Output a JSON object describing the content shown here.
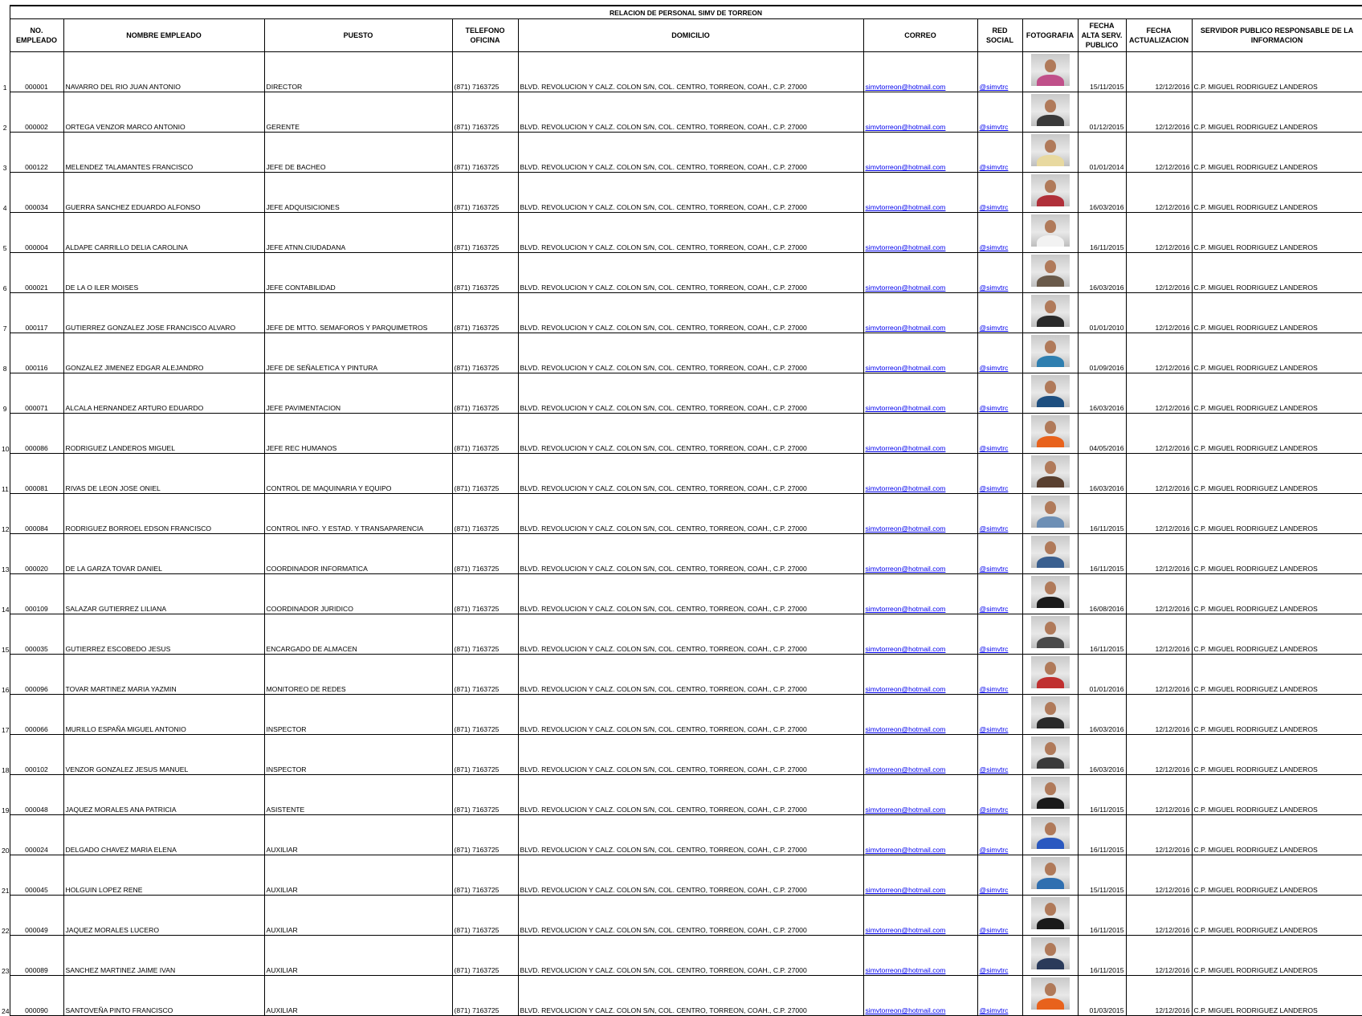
{
  "title": "RELACION DE PERSONAL SIMV DE TORREON",
  "headers": {
    "num": "NO. EMPLEADO",
    "nombre": "NOMBRE EMPLEADO",
    "puesto": "PUESTO",
    "telefono": "TELEFONO OFICINA",
    "domicilio": "DOMICILIO",
    "correo": "CORREO",
    "red": "RED SOCIAL",
    "foto": "FOTOGRAFIA",
    "alta": "FECHA ALTA SERV. PUBLICO",
    "actualizacion": "FECHA ACTUALIZACION",
    "responsable": "SERVIDOR PUBLICO RESPONSABLE DE LA INFORMACION"
  },
  "rows": [
    {
      "n": "1",
      "num": "000001",
      "nombre": "NAVARRO DEL RIO JUAN ANTONIO",
      "puesto": "DIRECTOR",
      "telefono": "(871) 7163725",
      "domicilio": "BLVD. REVOLUCION Y CALZ. COLON S/N, COL. CENTRO, TORREON, COAH., C.P. 27000",
      "correo": "simvtorreon@hotmail.com",
      "red": "@simvtrc",
      "alta": "15/11/2015",
      "act": "12/12/2016",
      "resp": "C.P. MIGUEL RODRIGUEZ LANDEROS",
      "shirt": "#c0508a"
    },
    {
      "n": "2",
      "num": "000002",
      "nombre": "ORTEGA VENZOR MARCO ANTONIO",
      "puesto": "GERENTE",
      "telefono": "(871) 7163725",
      "domicilio": "BLVD. REVOLUCION Y CALZ. COLON S/N, COL. CENTRO, TORREON, COAH., C.P. 27000",
      "correo": "simvtorreon@hotmail.com",
      "red": "@simvtrc",
      "alta": "01/12/2015",
      "act": "12/12/2016",
      "resp": "C.P. MIGUEL RODRIGUEZ LANDEROS",
      "shirt": "#3a3a3a"
    },
    {
      "n": "3",
      "num": "000122",
      "nombre": "MELENDEZ TALAMANTES FRANCISCO",
      "puesto": "JEFE  DE BACHEO",
      "telefono": "(871) 7163725",
      "domicilio": "BLVD. REVOLUCION Y CALZ. COLON S/N, COL. CENTRO, TORREON, COAH., C.P. 27000",
      "correo": "simvtorreon@hotmail.com",
      "red": "@simvtrc",
      "alta": "01/01/2014",
      "act": "12/12/2016",
      "resp": "C.P. MIGUEL RODRIGUEZ LANDEROS",
      "shirt": "#e8d9a0"
    },
    {
      "n": "4",
      "num": "000034",
      "nombre": "GUERRA SANCHEZ EDUARDO ALFONSO",
      "puesto": "JEFE ADQUISICIONES",
      "telefono": "(871) 7163725",
      "domicilio": "BLVD. REVOLUCION Y CALZ. COLON S/N, COL. CENTRO, TORREON, COAH., C.P. 27000",
      "correo": "simvtorreon@hotmail.com",
      "red": "@simvtrc",
      "alta": "16/03/2016",
      "act": "12/12/2016",
      "resp": "C.P. MIGUEL RODRIGUEZ LANDEROS",
      "shirt": "#b0303a"
    },
    {
      "n": "5",
      "num": "000004",
      "nombre": "ALDAPE CARRILLO DELIA CAROLINA",
      "puesto": "JEFE ATNN.CIUDADANA",
      "telefono": "(871) 7163725",
      "domicilio": "BLVD. REVOLUCION Y CALZ. COLON S/N, COL. CENTRO, TORREON, COAH., C.P. 27000",
      "correo": "simvtorreon@hotmail.com",
      "red": "@simvtrc",
      "alta": "16/11/2015",
      "act": "12/12/2016",
      "resp": "C.P. MIGUEL RODRIGUEZ LANDEROS",
      "shirt": "#f2f2f2"
    },
    {
      "n": "6",
      "num": "000021",
      "nombre": "DE LA O ILER MOISES",
      "puesto": "JEFE CONTABILIDAD",
      "telefono": "(871) 7163725",
      "domicilio": "BLVD. REVOLUCION Y CALZ. COLON S/N, COL. CENTRO, TORREON, COAH., C.P. 27000",
      "correo": "simvtorreon@hotmail.com",
      "red": "@simvtrc",
      "alta": "16/03/2016",
      "act": "12/12/2016",
      "resp": "C.P. MIGUEL RODRIGUEZ LANDEROS",
      "shirt": "#6a5a4a"
    },
    {
      "n": "7",
      "num": "000117",
      "nombre": "GUTIERREZ GONZALEZ JOSE FRANCISCO ALVARO",
      "puesto": "JEFE DE MTTO.  SEMAFOROS Y PARQUIMETROS",
      "telefono": "(871) 7163725",
      "domicilio": "BLVD. REVOLUCION Y CALZ. COLON S/N, COL. CENTRO, TORREON, COAH., C.P. 27000",
      "correo": "simvtorreon@hotmail.com",
      "red": "@simvtrc",
      "alta": "01/01/2010",
      "act": "12/12/2016",
      "resp": "C.P. MIGUEL RODRIGUEZ LANDEROS",
      "shirt": "#2a2a2a"
    },
    {
      "n": "8",
      "num": "000116",
      "nombre": "GONZALEZ JIMENEZ EDGAR ALEJANDRO",
      "puesto": "JEFE DE SEÑALETICA Y PINTURA",
      "telefono": "(871) 7163725",
      "domicilio": "BLVD. REVOLUCION Y CALZ. COLON S/N, COL. CENTRO, TORREON, COAH., C.P. 27000",
      "correo": "simvtorreon@hotmail.com",
      "red": "@simvtrc",
      "alta": "01/09/2016",
      "act": "12/12/2016",
      "resp": "C.P. MIGUEL RODRIGUEZ LANDEROS",
      "shirt": "#2f7fb0"
    },
    {
      "n": "9",
      "num": "000071",
      "nombre": "ALCALA HERNANDEZ ARTURO EDUARDO",
      "puesto": "JEFE PAVIMENTACION",
      "telefono": "(871) 7163725",
      "domicilio": "BLVD. REVOLUCION Y CALZ. COLON S/N, COL. CENTRO, TORREON, COAH., C.P. 27000",
      "correo": "simvtorreon@hotmail.com",
      "red": "@simvtrc",
      "alta": "16/03/2016",
      "act": "12/12/2016",
      "resp": "C.P. MIGUEL RODRIGUEZ LANDEROS",
      "shirt": "#1e4f80"
    },
    {
      "n": "10",
      "num": "000086",
      "nombre": "RODRIGUEZ LANDEROS MIGUEL",
      "puesto": "JEFE REC HUMANOS",
      "telefono": "(871) 7163725",
      "domicilio": "BLVD. REVOLUCION Y CALZ. COLON S/N, COL. CENTRO, TORREON, COAH., C.P. 27000",
      "correo": "simvtorreon@hotmail.com",
      "red": "@simvtrc",
      "alta": "04/05/2016",
      "act": "12/12/2016",
      "resp": "C.P. MIGUEL RODRIGUEZ LANDEROS",
      "shirt": "#e8621c"
    },
    {
      "n": "11",
      "num": "000081",
      "nombre": "RIVAS DE LEON JOSE ONIEL",
      "puesto": "CONTROL DE MAQUINARIA Y EQUIPO",
      "telefono": "(871) 7163725",
      "domicilio": "BLVD. REVOLUCION Y CALZ. COLON S/N, COL. CENTRO, TORREON, COAH., C.P. 27000",
      "correo": "simvtorreon@hotmail.com",
      "red": "@simvtrc",
      "alta": "16/03/2016",
      "act": "12/12/2016",
      "resp": "C.P. MIGUEL RODRIGUEZ LANDEROS",
      "shirt": "#5a4030"
    },
    {
      "n": "12",
      "num": "000084",
      "nombre": "RODRIGUEZ BORROEL EDSON FRANCISCO",
      "puesto": "CONTROL INFO. Y ESTAD. Y TRANSAPARENCIA",
      "telefono": "(871) 7163725",
      "domicilio": "BLVD. REVOLUCION Y CALZ. COLON S/N, COL. CENTRO, TORREON, COAH., C.P. 27000",
      "correo": "simvtorreon@hotmail.com",
      "red": "@simvtrc",
      "alta": "16/11/2015",
      "act": "12/12/2016",
      "resp": "C.P. MIGUEL RODRIGUEZ LANDEROS",
      "shirt": "#6d8fb5"
    },
    {
      "n": "13",
      "num": "000020",
      "nombre": "DE LA GARZA TOVAR DANIEL",
      "puesto": "COORDINADOR INFORMATICA",
      "telefono": "(871) 7163725",
      "domicilio": "BLVD. REVOLUCION Y CALZ. COLON S/N, COL. CENTRO, TORREON, COAH., C.P. 27000",
      "correo": "simvtorreon@hotmail.com",
      "red": "@simvtrc",
      "alta": "16/11/2015",
      "act": "12/12/2016",
      "resp": "C.P. MIGUEL RODRIGUEZ LANDEROS",
      "shirt": "#3a5f8f"
    },
    {
      "n": "14",
      "num": "000109",
      "nombre": "SALAZAR GUTIERREZ LILIANA",
      "puesto": "COORDINADOR JURIDICO",
      "telefono": "(871) 7163725",
      "domicilio": "BLVD. REVOLUCION Y CALZ. COLON S/N, COL. CENTRO, TORREON, COAH., C.P. 27000",
      "correo": "simvtorreon@hotmail.com",
      "red": "@simvtrc",
      "alta": "16/08/2016",
      "act": "12/12/2016",
      "resp": "C.P. MIGUEL RODRIGUEZ LANDEROS",
      "shirt": "#1a1a1a"
    },
    {
      "n": "15",
      "num": "000035",
      "nombre": "GUTIERREZ ESCOBEDO JESUS",
      "puesto": "ENCARGADO DE ALMACEN",
      "telefono": "(871) 7163725",
      "domicilio": "BLVD. REVOLUCION Y CALZ. COLON S/N, COL. CENTRO, TORREON, COAH., C.P. 27000",
      "correo": "simvtorreon@hotmail.com",
      "red": "@simvtrc",
      "alta": "16/11/2015",
      "act": "12/12/2016",
      "resp": "C.P. MIGUEL RODRIGUEZ LANDEROS",
      "shirt": "#4a4a4a"
    },
    {
      "n": "16",
      "num": "000096",
      "nombre": "TOVAR MARTINEZ MARIA YAZMIN",
      "puesto": "MONITOREO DE REDES",
      "telefono": "(871) 7163725",
      "domicilio": "BLVD. REVOLUCION Y CALZ. COLON S/N, COL. CENTRO, TORREON, COAH., C.P. 27000",
      "correo": "simvtorreon@hotmail.com",
      "red": "@simvtrc",
      "alta": "01/01/2016",
      "act": "12/12/2016",
      "resp": "C.P. MIGUEL RODRIGUEZ LANDEROS",
      "shirt": "#c03030"
    },
    {
      "n": "17",
      "num": "000066",
      "nombre": "MURILLO ESPAÑA MIGUEL ANTONIO",
      "puesto": "INSPECTOR",
      "telefono": "(871) 7163725",
      "domicilio": "BLVD. REVOLUCION Y CALZ. COLON S/N, COL. CENTRO, TORREON, COAH., C.P. 27000",
      "correo": "simvtorreon@hotmail.com",
      "red": "@simvtrc",
      "alta": "16/03/2016",
      "act": "12/12/2016",
      "resp": "C.P. MIGUEL RODRIGUEZ LANDEROS",
      "shirt": "#2a2a2a"
    },
    {
      "n": "18",
      "num": "000102",
      "nombre": "VENZOR GONZALEZ JESUS MANUEL",
      "puesto": "INSPECTOR",
      "telefono": "(871) 7163725",
      "domicilio": "BLVD. REVOLUCION Y CALZ. COLON S/N, COL. CENTRO, TORREON, COAH., C.P. 27000",
      "correo": "simvtorreon@hotmail.com",
      "red": "@simvtrc",
      "alta": "16/03/2016",
      "act": "12/12/2016",
      "resp": "C.P. MIGUEL RODRIGUEZ LANDEROS",
      "shirt": "#3a3a3a"
    },
    {
      "n": "19",
      "num": "000048",
      "nombre": "JAQUEZ MORALES ANA PATRICIA",
      "puesto": "ASISTENTE",
      "telefono": "(871) 7163725",
      "domicilio": "BLVD. REVOLUCION Y CALZ. COLON S/N, COL. CENTRO, TORREON, COAH., C.P. 27000",
      "correo": "simvtorreon@hotmail.com",
      "red": "@simvtrc",
      "alta": "16/11/2015",
      "act": "12/12/2016",
      "resp": "C.P. MIGUEL RODRIGUEZ LANDEROS",
      "shirt": "#1a1a1a"
    },
    {
      "n": "20",
      "num": "000024",
      "nombre": "DELGADO CHAVEZ MARIA ELENA",
      "puesto": "AUXILIAR",
      "telefono": "(871) 7163725",
      "domicilio": "BLVD. REVOLUCION Y CALZ. COLON S/N, COL. CENTRO, TORREON, COAH., C.P. 27000",
      "correo": "simvtorreon@hotmail.com",
      "red": "@simvtrc",
      "alta": "16/11/2015",
      "act": "12/12/2016",
      "resp": "C.P. MIGUEL RODRIGUEZ LANDEROS",
      "shirt": "#2a58c0"
    },
    {
      "n": "21",
      "num": "000045",
      "nombre": "HOLGUIN LOPEZ RENE",
      "puesto": "AUXILIAR",
      "telefono": "(871) 7163725",
      "domicilio": "BLVD. REVOLUCION Y CALZ. COLON S/N, COL. CENTRO, TORREON, COAH., C.P. 27000",
      "correo": "simvtorreon@hotmail.com",
      "red": "@simvtrc",
      "alta": "15/11/2015",
      "act": "12/12/2016",
      "resp": "C.P. MIGUEL RODRIGUEZ LANDEROS",
      "shirt": "#2f6fb0"
    },
    {
      "n": "22",
      "num": "000049",
      "nombre": "JAQUEZ MORALES LUCERO",
      "puesto": "AUXILIAR",
      "telefono": "(871) 7163725",
      "domicilio": "BLVD. REVOLUCION Y CALZ. COLON S/N, COL. CENTRO, TORREON, COAH., C.P. 27000",
      "correo": "simvtorreon@hotmail.com",
      "red": "@simvtrc",
      "alta": "16/11/2015",
      "act": "12/12/2016",
      "resp": "C.P. MIGUEL RODRIGUEZ LANDEROS",
      "shirt": "#1a1a1a"
    },
    {
      "n": "23",
      "num": "000089",
      "nombre": "SANCHEZ MARTINEZ JAIME IVAN",
      "puesto": "AUXILIAR",
      "telefono": "(871) 7163725",
      "domicilio": "BLVD. REVOLUCION Y CALZ. COLON S/N, COL. CENTRO, TORREON, COAH., C.P. 27000",
      "correo": "simvtorreon@hotmail.com",
      "red": "@simvtrc",
      "alta": "16/11/2015",
      "act": "12/12/2016",
      "resp": "C.P. MIGUEL RODRIGUEZ LANDEROS",
      "shirt": "#2a3a5a"
    },
    {
      "n": "24",
      "num": "000090",
      "nombre": "SANTOVEÑA PINTO FRANCISCO",
      "puesto": "AUXILIAR",
      "telefono": "(871) 7163725",
      "domicilio": "BLVD. REVOLUCION Y CALZ. COLON S/N, COL. CENTRO, TORREON, COAH., C.P. 27000",
      "correo": "simvtorreon@hotmail.com",
      "red": "@simvtrc",
      "alta": "01/03/2015",
      "act": "12/12/2016",
      "resp": "C.P. MIGUEL RODRIGUEZ LANDEROS",
      "shirt": "#e8621c"
    }
  ]
}
